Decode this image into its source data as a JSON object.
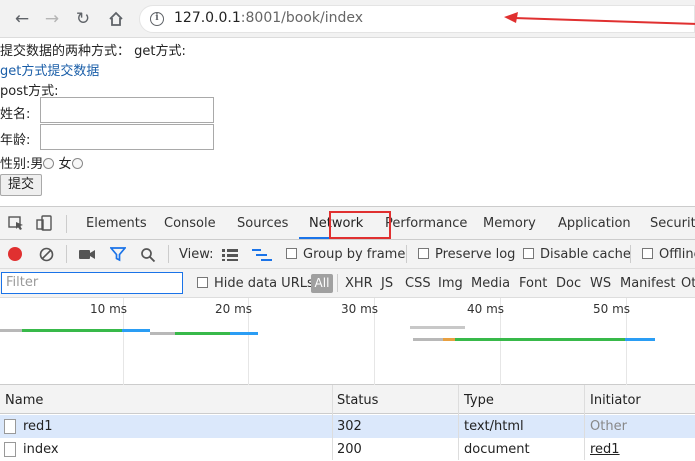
{
  "browser": {
    "url_host": "127.0.0.1",
    "url_rest": ":8001/book/index",
    "accent_color": "#e03030"
  },
  "page": {
    "intro_text": "提交数据的两种方式：  get方式:",
    "get_link": "get方式提交数据",
    "post_text": "post方式:",
    "name_label": "姓名:",
    "age_label": "年龄:",
    "gender_label": "性别:",
    "male_label": "男",
    "female_label": "女",
    "submit_label": "提交"
  },
  "devtools": {
    "tabs": [
      "Elements",
      "Console",
      "Sources",
      "Network",
      "Performance",
      "Memory",
      "Application",
      "Security"
    ],
    "active_tab": "Network",
    "controls": {
      "view_label": "View:",
      "group_by_frame": "Group by frame",
      "preserve_log": "Preserve log",
      "disable_cache": "Disable cache",
      "offline": "Offline"
    },
    "filter": {
      "placeholder": "Filter",
      "hide_data_urls": "Hide data URLs",
      "all": "All",
      "types": [
        "XHR",
        "JS",
        "CSS",
        "Img",
        "Media",
        "Font",
        "Doc",
        "WS",
        "Manifest",
        "Ot"
      ]
    },
    "timeline": {
      "ticks": [
        "10 ms",
        "20 ms",
        "30 ms",
        "40 ms",
        "50 ms"
      ]
    },
    "table": {
      "headers": [
        "Name",
        "Status",
        "Type",
        "Initiator"
      ],
      "rows": [
        {
          "name": "red1",
          "status": "302",
          "type": "text/html",
          "initiator": "Other"
        },
        {
          "name": "index",
          "status": "200",
          "type": "document",
          "initiator": "red1"
        }
      ]
    }
  }
}
